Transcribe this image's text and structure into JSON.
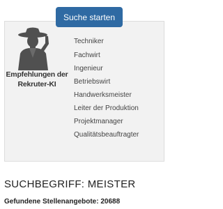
{
  "search": {
    "button_label": "Suche starten"
  },
  "recommendations": {
    "avatar_icon": "agent-avatar-icon",
    "caption_line1": "Empfehlungen der",
    "caption_line2": "Rekruter-KI",
    "jobs": [
      "Techniker",
      "Fachwirt",
      "Ingenieur",
      "Betriebswirt",
      "Handwerksmeister",
      "Leiter der Produktion",
      "Projektmanager",
      "Qualitätsbeauftragter"
    ]
  },
  "results": {
    "search_term": "SUCHBEGRIFF: MEISTER",
    "found_label": "Gefundene Stellenangebote: 20688"
  },
  "colors": {
    "button": "#2f6aa3",
    "panel": "#f2f2f2"
  }
}
